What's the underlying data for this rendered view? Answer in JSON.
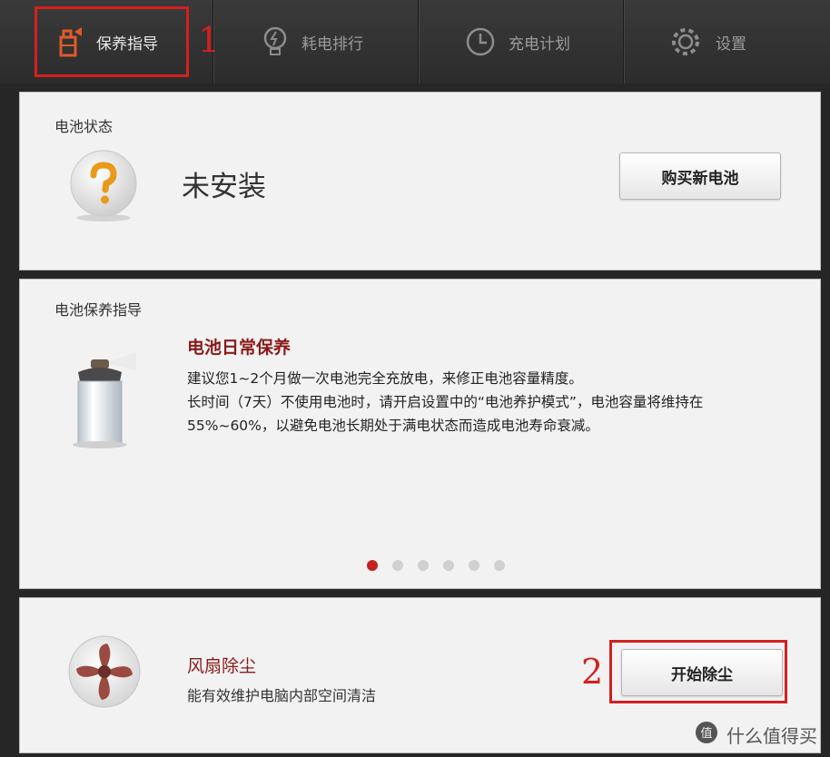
{
  "nav": {
    "tabs": [
      {
        "label": "保养指导",
        "icon": "battery-spray-icon",
        "active": true
      },
      {
        "label": "耗电排行",
        "icon": "bulb-icon",
        "active": false
      },
      {
        "label": "充电计划",
        "icon": "clock-icon",
        "active": false
      },
      {
        "label": "设置",
        "icon": "gear-icon",
        "active": false
      }
    ]
  },
  "annotations": {
    "first": "1",
    "second": "2",
    "highlight_color": "#d42020"
  },
  "battery_status": {
    "title": "电池状态",
    "status": "未安装",
    "buy_button": "购买新电池",
    "icon": "question-icon"
  },
  "maintenance_guide": {
    "title": "电池保养指导",
    "heading": "电池日常保养",
    "text": "建议您1~2个月做一次电池完全充放电，来修正电池容量精度。\n长时间（7天）不使用电池时，请开启设置中的“电池养护模式”，电池容量将维持在55%~60%，以避免电池长期处于满电状态而造成电池寿命衰减。",
    "icon": "spray-can-icon",
    "pages_total": 6,
    "current_page": 1
  },
  "fan_cleaning": {
    "heading": "风扇除尘",
    "desc": "能有效维护电脑内部空间清洁",
    "button": "开始除尘",
    "icon": "fan-icon"
  },
  "watermark": {
    "text": "什么值得买",
    "icon": "zhi-logo-icon"
  },
  "colors": {
    "accent_red": "#c62020",
    "heading_red": "#8a1a1a",
    "topbar_bg": "#333333"
  }
}
